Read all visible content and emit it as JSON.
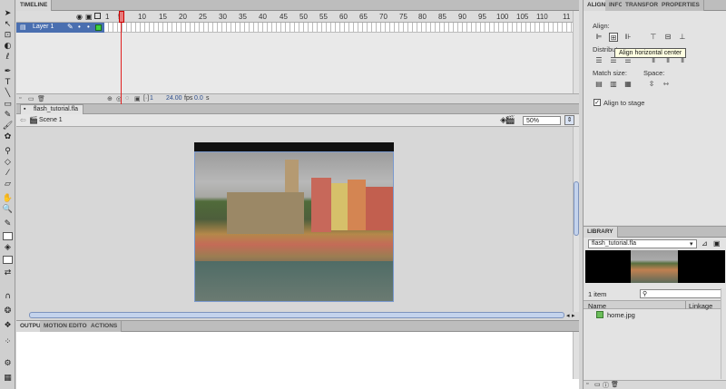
{
  "timeline": {
    "tab_label": "TIMELINE",
    "frame_numbers": [
      "1",
      "5",
      "10",
      "15",
      "20",
      "25",
      "30",
      "35",
      "40",
      "45",
      "50",
      "55",
      "60",
      "65",
      "70",
      "75",
      "80",
      "85",
      "90",
      "95",
      "100",
      "105",
      "110",
      "11"
    ],
    "layer_name": "Layer 1",
    "status": {
      "frame": "1",
      "fps": "24.00",
      "fps_unit": "fps",
      "time": "0.0",
      "time_unit": "s"
    }
  },
  "document": {
    "tab_label": "flash_tutorial.fla",
    "scene_label": "Scene 1",
    "zoom": "50%"
  },
  "output": {
    "tabs": [
      "OUTPUT",
      "MOTION EDITOR",
      "ACTIONS"
    ]
  },
  "align_panel": {
    "tabs": [
      "ALIGN",
      "INFO",
      "TRANSFORM",
      "PROPERTIES"
    ],
    "align_label": "Align:",
    "distribute_label": "Distribute:",
    "match_size_label": "Match size:",
    "space_label": "Space:",
    "tooltip": "Align horizontal center",
    "align_to_stage_label": "Align to stage",
    "align_to_stage_checked": true
  },
  "library": {
    "tab_label": "LIBRARY",
    "document_select": "flash_tutorial.fla",
    "item_count": "1 item",
    "columns": [
      "Name",
      "Linkage"
    ],
    "items": [
      {
        "name": "home.jpg",
        "icon": "bitmap-icon"
      }
    ]
  },
  "colors": {
    "playhead": "#e02020",
    "layer_selected": "#4a6fb0",
    "stage_border": "#7a9acf",
    "tooltip_bg": "#ffffe1"
  }
}
